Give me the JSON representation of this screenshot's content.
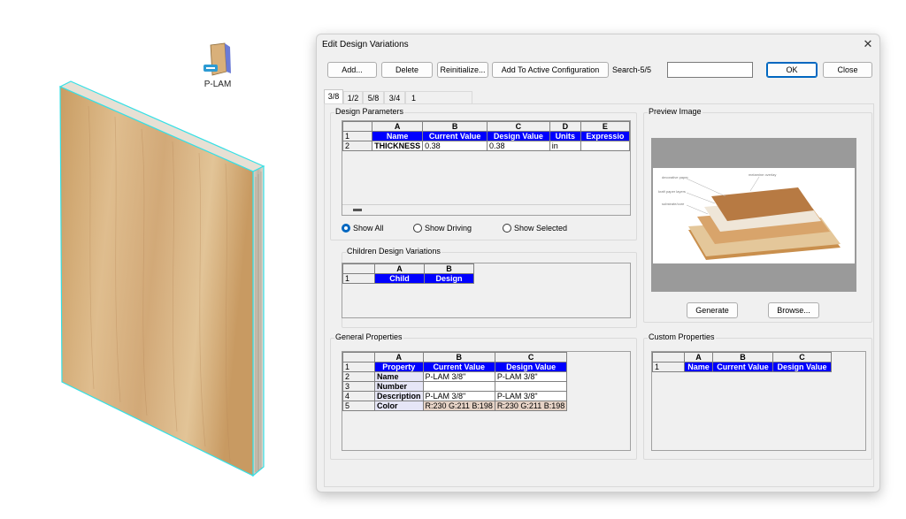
{
  "desktop": {
    "icon_label": "P-LAM"
  },
  "dialog": {
    "title": "Edit Design Variations",
    "close_glyph": "✕",
    "toolbar": {
      "add": "Add...",
      "delete": "Delete",
      "reinitialize": "Reinitialize...",
      "add_active": "Add To Active Configuration",
      "search_label": "Search-5/5",
      "search_value": "",
      "ok": "OK",
      "close": "Close"
    },
    "tabs": [
      "3/8",
      "1/2",
      "5/8",
      "3/4",
      "1"
    ],
    "active_tab": 0,
    "design_parameters": {
      "title": "Design Parameters",
      "columns": [
        "A",
        "B",
        "C",
        "D",
        "E"
      ],
      "header_row": [
        "Name",
        "Current Value",
        "Design Value",
        "Units",
        "Expressio"
      ],
      "rows": [
        [
          "THICKNESS",
          "0.38",
          "0.38",
          "in",
          ""
        ]
      ],
      "row_numbers": [
        "1",
        "2"
      ],
      "scrollbar_glyph": "▬"
    },
    "show_options": {
      "all": "Show All",
      "driving": "Show Driving",
      "selected": "Show Selected",
      "selected_index": 0
    },
    "children": {
      "title": "Children Design Variations",
      "columns": [
        "A",
        "B"
      ],
      "header_row": [
        "Child",
        "Design"
      ],
      "row_numbers": [
        "1"
      ]
    },
    "general": {
      "title": "General Properties",
      "columns": [
        "A",
        "B",
        "C"
      ],
      "header_row": [
        "Property",
        "Current Value",
        "Design Value"
      ],
      "rows": [
        [
          "Name",
          "P-LAM 3/8\"",
          "P-LAM 3/8\""
        ],
        [
          "Number",
          "",
          ""
        ],
        [
          "Description",
          "P-LAM 3/8\"",
          "P-LAM 3/8\""
        ],
        [
          "Color",
          "R:230 G:211 B:198",
          "R:230 G:211 B:198"
        ]
      ],
      "row_numbers": [
        "1",
        "2",
        "3",
        "4",
        "5"
      ]
    },
    "custom": {
      "title": "Custom Properties",
      "columns": [
        "A",
        "B",
        "C"
      ],
      "header_row": [
        "Name",
        "Current Value",
        "Design Value"
      ],
      "row_numbers": [
        "1"
      ]
    },
    "preview": {
      "title": "Preview Image",
      "labels": [
        "decorative paper",
        "melamine overlay",
        "kraft paper layers",
        "substrate/core"
      ],
      "generate": "Generate",
      "browse": "Browse..."
    }
  },
  "colors": {
    "accent": "#0067c0",
    "grid_header_blue": "#0000ff",
    "wood": "#d9b88a",
    "edge_highlight": "#35e0e6",
    "color_swatch": "#e6d3c6"
  }
}
